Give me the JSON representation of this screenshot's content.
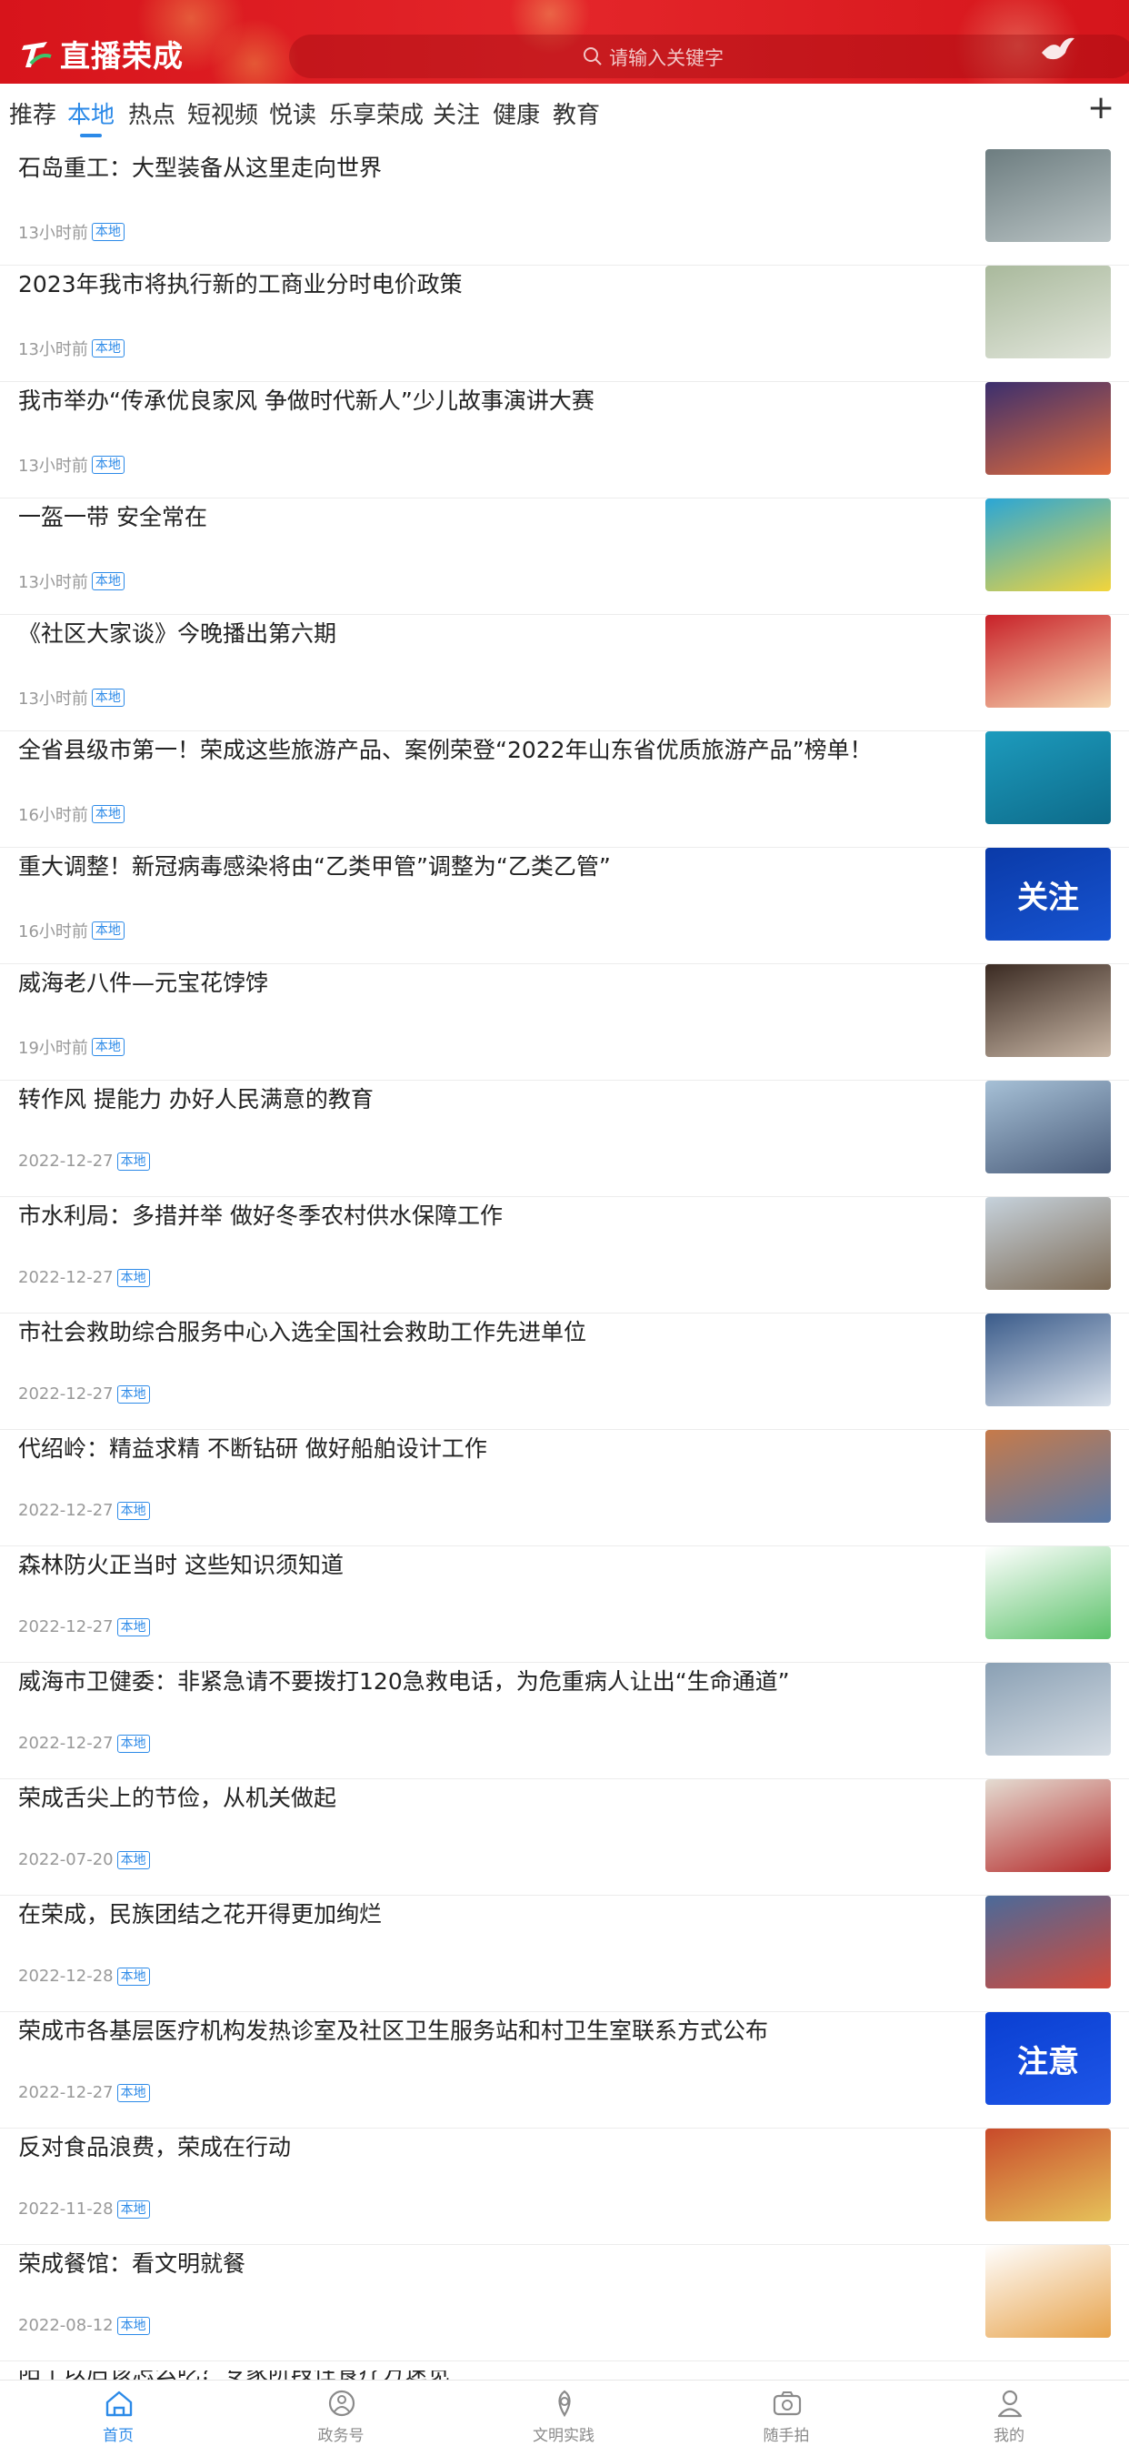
{
  "header": {
    "app_title": "直播荣成",
    "search_placeholder": "请输入关键字"
  },
  "tabs": [
    "推荐",
    "本地",
    "热点",
    "短视频",
    "悦读",
    "乐享荣成",
    "关注",
    "健康",
    "教育"
  ],
  "active_tab": "本地",
  "tab_add_label": "+",
  "news": [
    {
      "title": "石岛重工：大型装备从这里走向世界",
      "time": "13小时前",
      "badge": "本地"
    },
    {
      "title": "2023年我市将执行新的工商业分时电价政策",
      "time": "13小时前",
      "badge": "本地"
    },
    {
      "title": "我市举办“传承优良家风  争做时代新人”少儿故事演讲大赛",
      "time": "13小时前",
      "badge": "本地"
    },
    {
      "title": "一盔一带  安全常在",
      "time": "13小时前",
      "badge": "本地"
    },
    {
      "title": "《社区大家谈》今晚播出第六期",
      "time": "13小时前",
      "badge": "本地"
    },
    {
      "title": "全省县级市第一！荣成这些旅游产品、案例荣登“2022年山东省优质旅游产品”榜单！",
      "time": "16小时前",
      "badge": "本地"
    },
    {
      "title": "重大调整！新冠病毒感染将由“乙类甲管”调整为“乙类乙管”",
      "time": "16小时前",
      "badge": "本地",
      "thumb_text": "关注"
    },
    {
      "title": "威海老八件—元宝花饽饽",
      "time": "19小时前",
      "badge": "本地"
    },
    {
      "title": "转作风  提能力  办好人民满意的教育",
      "time": "2022-12-27",
      "badge": "本地"
    },
    {
      "title": "市水利局：多措并举  做好冬季农村供水保障工作",
      "time": "2022-12-27",
      "badge": "本地"
    },
    {
      "title": "市社会救助综合服务中心入选全国社会救助工作先进单位",
      "time": "2022-12-27",
      "badge": "本地"
    },
    {
      "title": "代绍岭：精益求精  不断钻研  做好船舶设计工作",
      "time": "2022-12-27",
      "badge": "本地"
    },
    {
      "title": "森林防火正当时  这些知识须知道",
      "time": "2022-12-27",
      "badge": "本地"
    },
    {
      "title": "威海市卫健委：非紧急请不要拨打120急救电话，为危重病人让出“生命通道”",
      "time": "2022-12-27",
      "badge": "本地"
    },
    {
      "title": "荣成舌尖上的节俭，从机关做起",
      "time": "2022-07-20",
      "badge": "本地"
    },
    {
      "title": "在荣成，民族团结之花开得更加绚烂",
      "time": "2022-12-28",
      "badge": "本地"
    },
    {
      "title": "荣成市各基层医疗机构发热诊室及社区卫生服务站和村卫生室联系方式公布",
      "time": "2022-12-27",
      "badge": "本地",
      "thumb_text": "注意"
    },
    {
      "title": "反对食品浪费，荣成在行动",
      "time": "2022-11-28",
      "badge": "本地"
    },
    {
      "title": "荣成餐馆：看文明就餐",
      "time": "2022-08-12",
      "badge": "本地"
    }
  ],
  "thumb_colors": [
    [
      "#6d7d80",
      "#b9c3c4"
    ],
    [
      "#a9b99c",
      "#e2e6dc"
    ],
    [
      "#3b2f6e",
      "#e26b3a"
    ],
    [
      "#2aa6d6",
      "#f2d53b"
    ],
    [
      "#c82128",
      "#f6d6b0"
    ],
    [
      "#1d9bbd",
      "#0d6b8a"
    ],
    [
      "#0a3aa8",
      "#1754d1"
    ],
    [
      "#3a2a22",
      "#c9b7a6"
    ],
    [
      "#a6c0d6",
      "#4a5c7a"
    ],
    [
      "#c6d2dc",
      "#7d6a54"
    ],
    [
      "#3a5b8a",
      "#d8e0ea"
    ],
    [
      "#c67a4a",
      "#5a7aa8"
    ],
    [
      "#ffffff",
      "#5cc26a"
    ],
    [
      "#8aa0b4",
      "#d6dde4"
    ],
    [
      "#e4dcd2",
      "#b52a2a"
    ],
    [
      "#4a6a9a",
      "#d24a3a"
    ],
    [
      "#0a3fd1",
      "#1e56e8"
    ],
    [
      "#c84a2a",
      "#e6c25a"
    ],
    [
      "#ffffff",
      "#e7a24a"
    ]
  ],
  "bottom_nav": [
    {
      "label": "首页",
      "icon": "home-icon",
      "active": true
    },
    {
      "label": "政务号",
      "icon": "government-account-icon",
      "active": false
    },
    {
      "label": "文明实践",
      "icon": "civilization-practice-icon",
      "active": false
    },
    {
      "label": "随手拍",
      "icon": "camera-icon",
      "active": false
    },
    {
      "label": "我的",
      "icon": "user-profile-icon",
      "active": false
    }
  ],
  "colors": {
    "accent": "#2c8ae8",
    "header_red": "#d7141b"
  },
  "partial_item_title": "阳了以后该怎么吃？专家阶段性食疗方速览"
}
